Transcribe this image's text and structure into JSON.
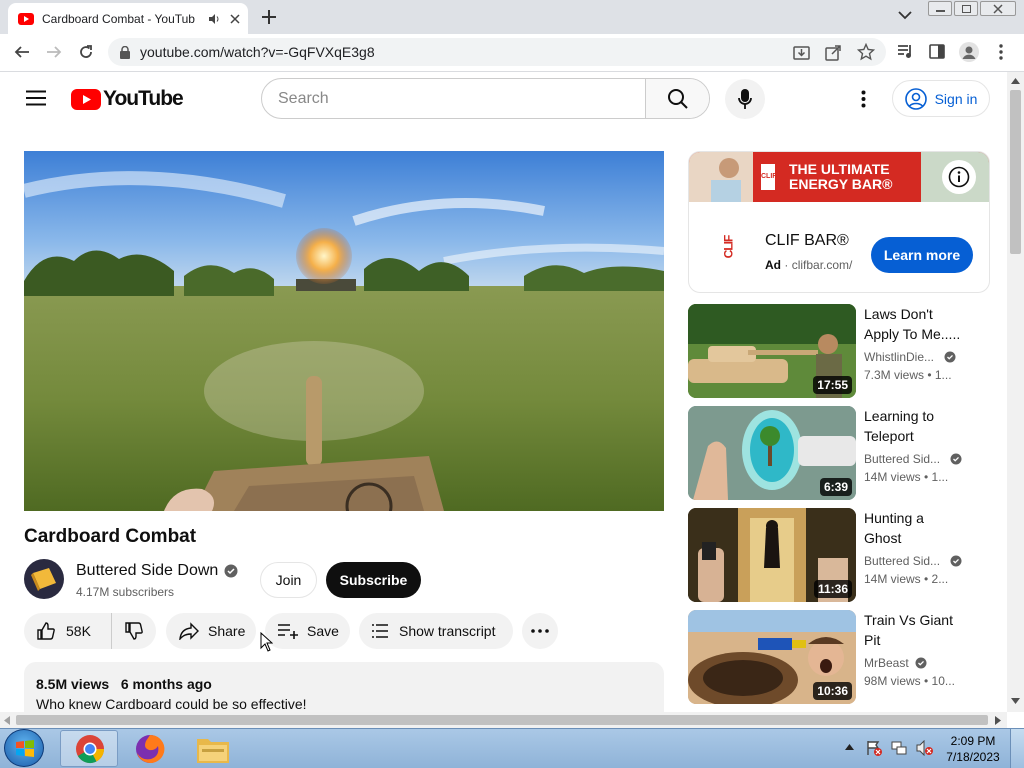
{
  "browser": {
    "tab_title": "Cardboard Combat - YouTub",
    "url": "youtube.com/watch?v=-GqFVXqE3g8"
  },
  "header": {
    "logo_text": "YouTube",
    "search_placeholder": "Search",
    "signin_label": "Sign in"
  },
  "video": {
    "title": "Cardboard Combat",
    "channel": "Buttered Side Down",
    "subscribers": "4.17M subscribers",
    "join_label": "Join",
    "subscribe_label": "Subscribe",
    "likes": "58K",
    "share_label": "Share",
    "save_label": "Save",
    "transcript_label": "Show transcript",
    "views": "8.5M views",
    "age": "6 months ago",
    "description": "Who knew Cardboard could be so effective!"
  },
  "ad": {
    "banner_line1": "THE ULTIMATE",
    "banner_line2": "ENERGY BAR®",
    "brand_logo": "CLIF",
    "name": "CLIF BAR®",
    "label": "Ad",
    "domain": "clifbar.com/",
    "cta": "Learn more"
  },
  "related": [
    {
      "title_line1": "Laws Don't",
      "title_line2": "Apply To Me.....",
      "channel": "WhistlinDie...",
      "meta": "7.3M views  • 1...",
      "duration": "17:55"
    },
    {
      "title_line1": "Learning to",
      "title_line2": "Teleport",
      "channel": "Buttered Sid...",
      "meta": "14M views  • 1...",
      "duration": "6:39"
    },
    {
      "title_line1": "Hunting a",
      "title_line2": "Ghost",
      "channel": "Buttered Sid...",
      "meta": "14M views  • 2...",
      "duration": "11:36"
    },
    {
      "title_line1": "Train Vs Giant",
      "title_line2": "Pit",
      "channel": "MrBeast",
      "meta": "98M views  • 10...",
      "duration": "10:36"
    }
  ],
  "taskbar": {
    "time": "2:09 PM",
    "date": "7/18/2023"
  }
}
